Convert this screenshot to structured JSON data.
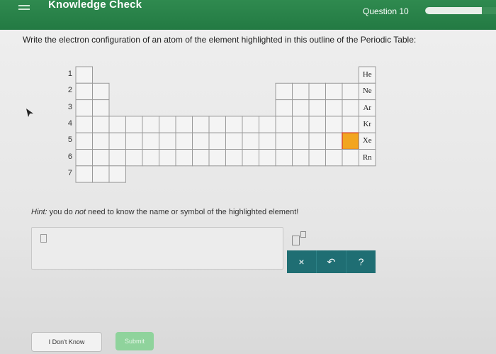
{
  "header": {
    "title": "Knowledge Check",
    "question_label": "Question 10",
    "progress_fraction": 0.8
  },
  "question": {
    "prompt": "Write the electron configuration of an atom of the element highlighted in this outline of the Periodic Table:",
    "period_labels": [
      "1",
      "2",
      "3",
      "4",
      "5",
      "6",
      "7"
    ],
    "noble_gases": [
      "He",
      "Ne",
      "Ar",
      "Kr",
      "Xe",
      "Rn"
    ],
    "highlight_color": "#f2a51f",
    "hint_label": "Hint:",
    "hint_pre": " you do ",
    "hint_em": "not",
    "hint_post": " need to know the name or symbol of the highlighted element!"
  },
  "answer": {
    "value": ""
  },
  "toolbar": {
    "clear_label": "×",
    "undo_label": "↶",
    "help_label": "?"
  },
  "buttons": {
    "dont_know": "I Don't Know",
    "submit": "Submit"
  },
  "colors": {
    "header_green": "#2f8a4f",
    "toolbar_teal": "#1f6e73",
    "submit_green": "#8fd39c"
  }
}
